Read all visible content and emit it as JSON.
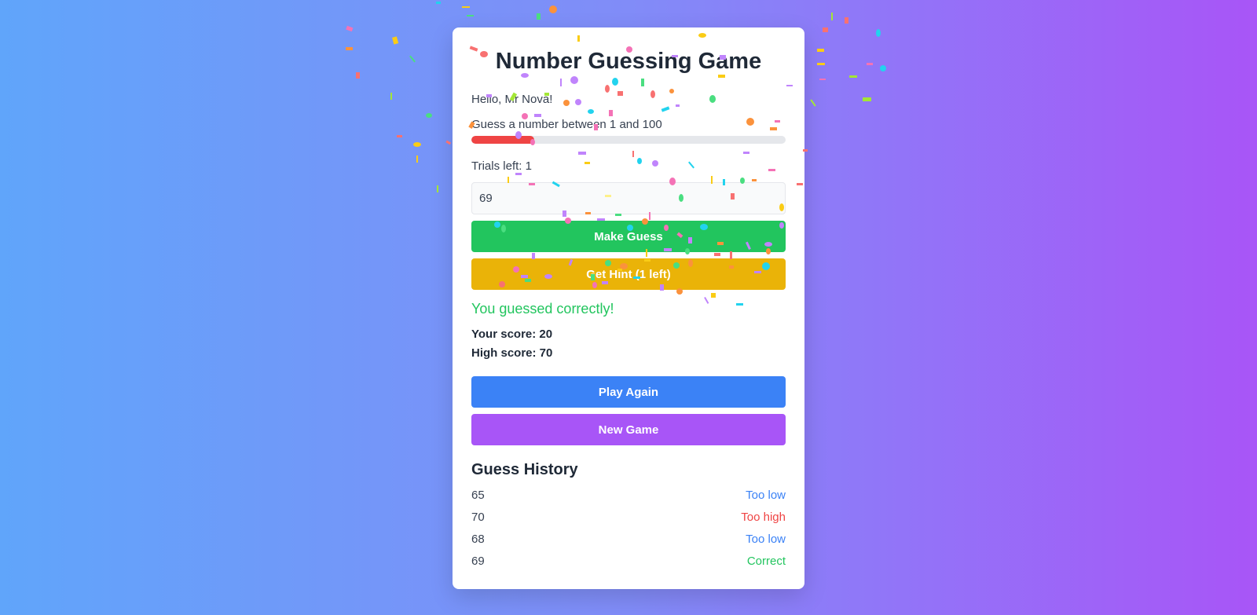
{
  "game": {
    "title": "Number Guessing Game",
    "greeting": "Hello, Mr Nova!",
    "instruction": "Guess a number between 1 and 100",
    "progress_fraction": 0.2,
    "progress_color": "#ef4444",
    "trials_left": "Trials left: 1",
    "guess_value": "69",
    "make_guess_label": "Make Guess",
    "hint_label": "Get Hint (1 left)",
    "result_message": "You guessed correctly!",
    "your_score": "Your score: 20",
    "high_score": "High score: 70",
    "play_again_label": "Play Again",
    "new_game_label": "New Game"
  },
  "history": {
    "title": "Guess History",
    "rows": [
      {
        "guess": "65",
        "result": "Too low",
        "color": "#3b82f6"
      },
      {
        "guess": "70",
        "result": "Too high",
        "color": "#ef4444"
      },
      {
        "guess": "68",
        "result": "Too low",
        "color": "#3b82f6"
      },
      {
        "guess": "69",
        "result": "Correct",
        "color": "#22c55e"
      }
    ]
  },
  "colors": {
    "make_guess": "#22c55e",
    "hint": "#eab308",
    "play_again": "#3b82f6",
    "new_game": "#a855f7",
    "success_text": "#22c55e"
  }
}
